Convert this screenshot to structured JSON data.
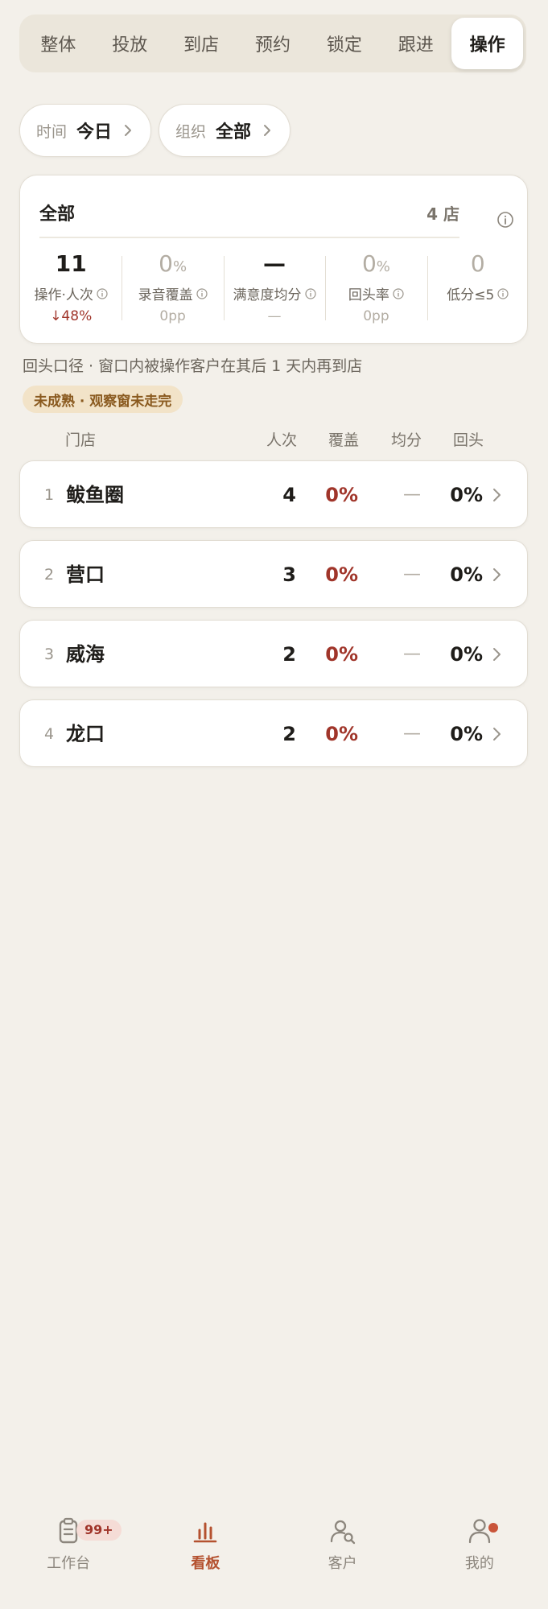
{
  "tabs": [
    {
      "label": "整体",
      "active": false
    },
    {
      "label": "投放",
      "active": false
    },
    {
      "label": "到店",
      "active": false
    },
    {
      "label": "预约",
      "active": false
    },
    {
      "label": "锁定",
      "active": false
    },
    {
      "label": "跟进",
      "active": false
    },
    {
      "label": "操作",
      "active": true
    }
  ],
  "filters": {
    "time": {
      "label": "时间",
      "value": "今日"
    },
    "org": {
      "label": "组织",
      "value": "全部"
    }
  },
  "summary": {
    "title": "全部",
    "store_count": "4 店",
    "metrics": [
      {
        "value": "11",
        "unit": "",
        "label": "操作·人次",
        "sub": "↓48%"
      },
      {
        "value": "0",
        "unit": "%",
        "label": "录音覆盖",
        "sub": "0pp"
      },
      {
        "value": "—",
        "unit": "",
        "label": "满意度均分",
        "sub": "—"
      },
      {
        "value": "0",
        "unit": "%",
        "label": "回头率",
        "sub": "0pp"
      },
      {
        "value": "0",
        "unit": "",
        "label": "低分≤5",
        "sub": ""
      }
    ]
  },
  "note": "回头口径 · 窗口内被操作客户在其后 1 天内再到店",
  "badge": "未成熟 · 观察窗未走完",
  "table": {
    "headers": {
      "store": "门店",
      "count": "人次",
      "cover": "覆盖",
      "avg": "均分",
      "back": "回头"
    },
    "rows": [
      {
        "rank": "1",
        "name": "鲅鱼圈",
        "count": "4",
        "cover": "0%",
        "avg": "—",
        "back": "0%"
      },
      {
        "rank": "2",
        "name": "营口",
        "count": "3",
        "cover": "0%",
        "avg": "—",
        "back": "0%"
      },
      {
        "rank": "3",
        "name": "威海",
        "count": "2",
        "cover": "0%",
        "avg": "—",
        "back": "0%"
      },
      {
        "rank": "4",
        "name": "龙口",
        "count": "2",
        "cover": "0%",
        "avg": "—",
        "back": "0%"
      }
    ]
  },
  "bottom_nav": [
    {
      "label": "工作台",
      "icon": "clipboard-icon",
      "badge": "99+"
    },
    {
      "label": "看板",
      "icon": "bar-chart-icon",
      "active": true
    },
    {
      "label": "客户",
      "icon": "user-search-icon"
    },
    {
      "label": "我的",
      "icon": "user-icon",
      "dot": true
    }
  ],
  "colors": {
    "background": "#f3f0ea",
    "accent": "#b4512f",
    "negative": "#a0352a",
    "badge_bg": "#f2e3c8",
    "badge_text": "#8a5a1f"
  }
}
